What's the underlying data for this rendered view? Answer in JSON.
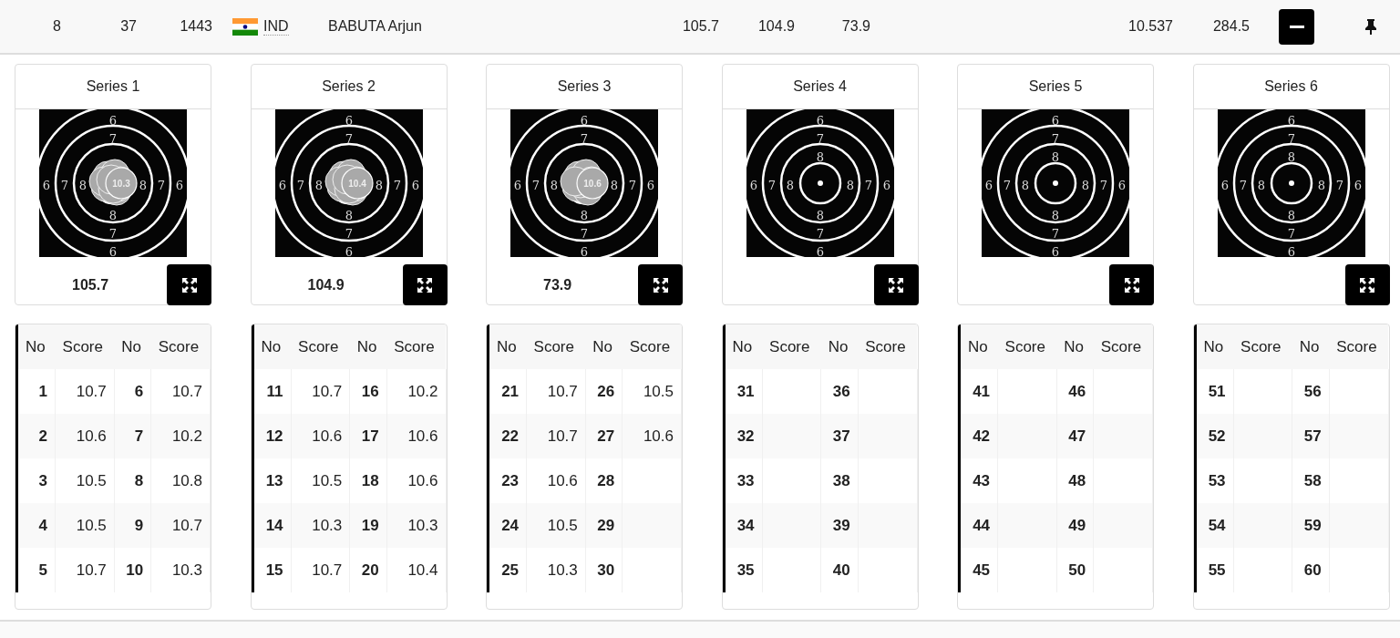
{
  "athlete_row": {
    "column_1": "8",
    "column_2": "37",
    "column_3": "1443",
    "nation": "IND",
    "name": "BABUTA Arjun",
    "series_totals": [
      "105.7",
      "104.9",
      "73.9"
    ],
    "column_4": "10.537",
    "column_5": "284.5",
    "expanded": true
  },
  "series": [
    {
      "title": "Series 1",
      "total": "105.7",
      "shot_label": "10.3",
      "ring_labels": [
        "6",
        "7",
        "6",
        "7",
        "8",
        "8",
        "7",
        "6",
        "8",
        "7",
        "6"
      ],
      "columns": [
        "No",
        "Score",
        "No",
        "Score"
      ],
      "rows": [
        {
          "no_1": "1",
          "score_1": "10.7",
          "no_2": "6",
          "score_2": "10.7"
        },
        {
          "no_1": "2",
          "score_1": "10.6",
          "no_2": "7",
          "score_2": "10.2"
        },
        {
          "no_1": "3",
          "score_1": "10.5",
          "no_2": "8",
          "score_2": "10.8"
        },
        {
          "no_1": "4",
          "score_1": "10.5",
          "no_2": "9",
          "score_2": "10.7"
        },
        {
          "no_1": "5",
          "score_1": "10.7",
          "no_2": "10",
          "score_2": "10.3"
        }
      ]
    },
    {
      "title": "Series 2",
      "total": "104.9",
      "shot_label": "10.4",
      "ring_labels": [
        "6",
        "7",
        "6",
        "7",
        "8",
        "8",
        "7",
        "6",
        "8",
        "7",
        "6"
      ],
      "columns": [
        "No",
        "Score",
        "No",
        "Score"
      ],
      "rows": [
        {
          "no_1": "11",
          "score_1": "10.7",
          "no_2": "16",
          "score_2": "10.2"
        },
        {
          "no_1": "12",
          "score_1": "10.6",
          "no_2": "17",
          "score_2": "10.6"
        },
        {
          "no_1": "13",
          "score_1": "10.5",
          "no_2": "18",
          "score_2": "10.6"
        },
        {
          "no_1": "14",
          "score_1": "10.3",
          "no_2": "19",
          "score_2": "10.3"
        },
        {
          "no_1": "15",
          "score_1": "10.7",
          "no_2": "20",
          "score_2": "10.4"
        }
      ]
    },
    {
      "title": "Series 3",
      "total": "73.9",
      "shot_label": "10.6",
      "ring_labels": [
        "6",
        "7",
        "6",
        "7",
        "8",
        "8",
        "7",
        "6",
        "8",
        "7",
        "6"
      ],
      "columns": [
        "No",
        "Score",
        "No",
        "Score"
      ],
      "rows": [
        {
          "no_1": "21",
          "score_1": "10.7",
          "no_2": "26",
          "score_2": "10.5"
        },
        {
          "no_1": "22",
          "score_1": "10.7",
          "no_2": "27",
          "score_2": "10.6"
        },
        {
          "no_1": "23",
          "score_1": "10.6",
          "no_2": "28"
        },
        {
          "no_1": "24",
          "score_1": "10.5",
          "no_2": "29"
        },
        {
          "no_1": "25",
          "score_1": "10.3",
          "no_2": "30"
        }
      ]
    },
    {
      "title": "Series 4",
      "ring_labels": [
        "6",
        "7",
        "8",
        "6",
        "7",
        "8",
        "8",
        "7",
        "6",
        "8",
        "7",
        "6"
      ],
      "columns": [
        "No",
        "Score",
        "No",
        "Score"
      ],
      "rows": [
        {
          "no_1": "31",
          "no_2": "36"
        },
        {
          "no_1": "32",
          "no_2": "37"
        },
        {
          "no_1": "33",
          "no_2": "38"
        },
        {
          "no_1": "34",
          "no_2": "39"
        },
        {
          "no_1": "35",
          "no_2": "40"
        }
      ]
    },
    {
      "title": "Series 5",
      "ring_labels": [
        "6",
        "7",
        "8",
        "6",
        "7",
        "8",
        "8",
        "7",
        "6",
        "8",
        "7",
        "6"
      ],
      "columns": [
        "No",
        "Score",
        "No",
        "Score"
      ],
      "rows": [
        {
          "no_1": "41",
          "no_2": "46"
        },
        {
          "no_1": "42",
          "no_2": "47"
        },
        {
          "no_1": "43",
          "no_2": "48"
        },
        {
          "no_1": "44",
          "no_2": "49"
        },
        {
          "no_1": "45",
          "no_2": "50"
        }
      ]
    },
    {
      "title": "Series 6",
      "ring_labels": [
        "6",
        "7",
        "8",
        "6",
        "7",
        "8",
        "8",
        "7",
        "6",
        "8",
        "7",
        "6"
      ],
      "columns": [
        "No",
        "Score",
        "No",
        "Score"
      ],
      "rows": [
        {
          "no_1": "51",
          "no_2": "56"
        },
        {
          "no_1": "52",
          "no_2": "57"
        },
        {
          "no_1": "53",
          "no_2": "58"
        },
        {
          "no_1": "54",
          "no_2": "59"
        },
        {
          "no_1": "55",
          "no_2": "60"
        }
      ]
    }
  ]
}
